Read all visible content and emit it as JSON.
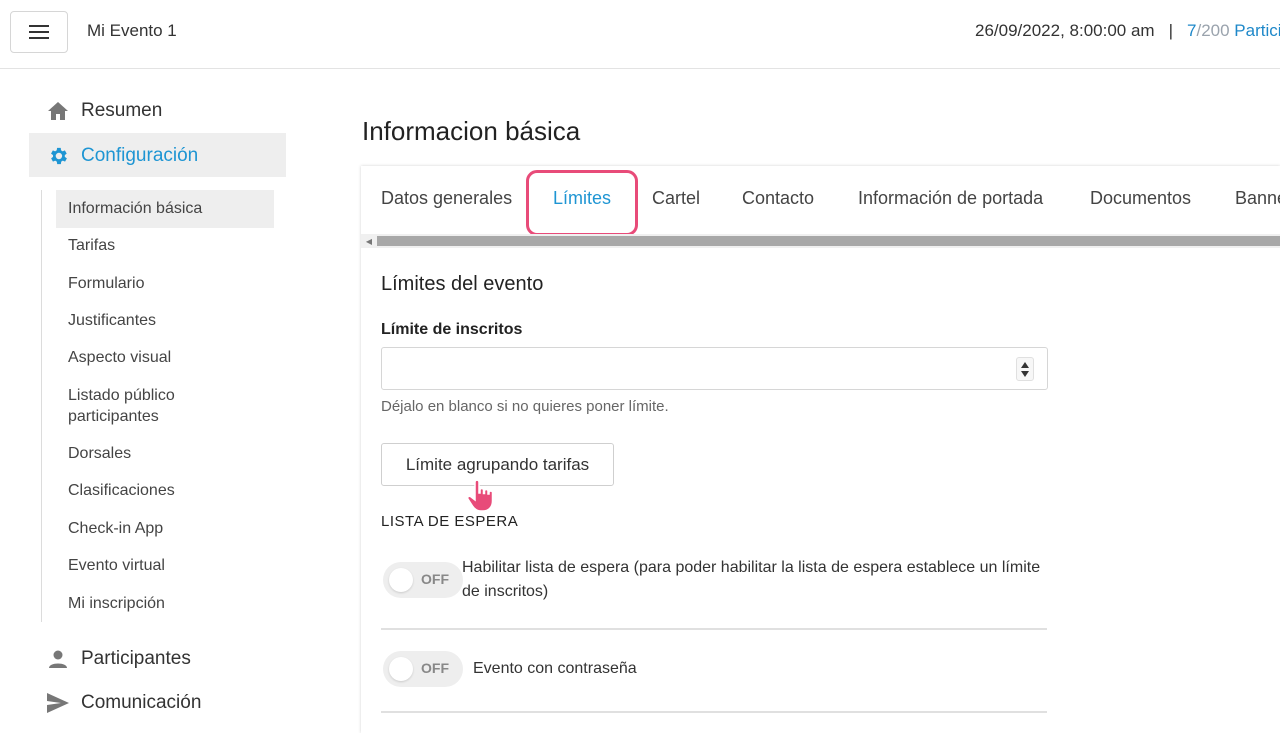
{
  "header": {
    "event_name": "Mi Evento 1",
    "datetime": "26/09/2022, 8:00:00 am",
    "separator": "|",
    "participants_count": "7",
    "participants_max": "/200",
    "participants_label": " Partici"
  },
  "sidebar": {
    "main_items": [
      {
        "label": "Resumen",
        "icon": "home-icon"
      },
      {
        "label": "Configuración",
        "icon": "gear-icon"
      },
      {
        "label": "Participantes",
        "icon": "person-icon"
      },
      {
        "label": "Comunicación",
        "icon": "send-icon"
      }
    ],
    "sub_items": [
      "Información básica",
      "Tarifas",
      "Formulario",
      "Justificantes",
      "Aspecto visual",
      "Listado público participantes",
      "Dorsales",
      "Clasificaciones",
      "Check-in App",
      "Evento virtual",
      "Mi inscripción"
    ]
  },
  "main": {
    "page_title": "Informacion básica",
    "tabs": [
      "Datos generales",
      "Límites",
      "Cartel",
      "Contacto",
      "Información de portada",
      "Documentos",
      "Banne"
    ],
    "section_title": "Límites del evento",
    "limit_label": "Límite de inscritos",
    "limit_value": "",
    "limit_help": "Déjalo en blanco si no quieres poner límite.",
    "group_button": "Límite agrupando tarifas",
    "waitlist_title": "LISTA DE ESPERA",
    "toggles": [
      {
        "state": "OFF",
        "text": "Habilitar lista de espera (para poder habilitar la lista de espera establece un límite de inscritos)"
      },
      {
        "state": "OFF",
        "text": "Evento con contraseña"
      }
    ]
  },
  "colors": {
    "accent": "#1e95d3",
    "highlight": "#e84b79"
  }
}
